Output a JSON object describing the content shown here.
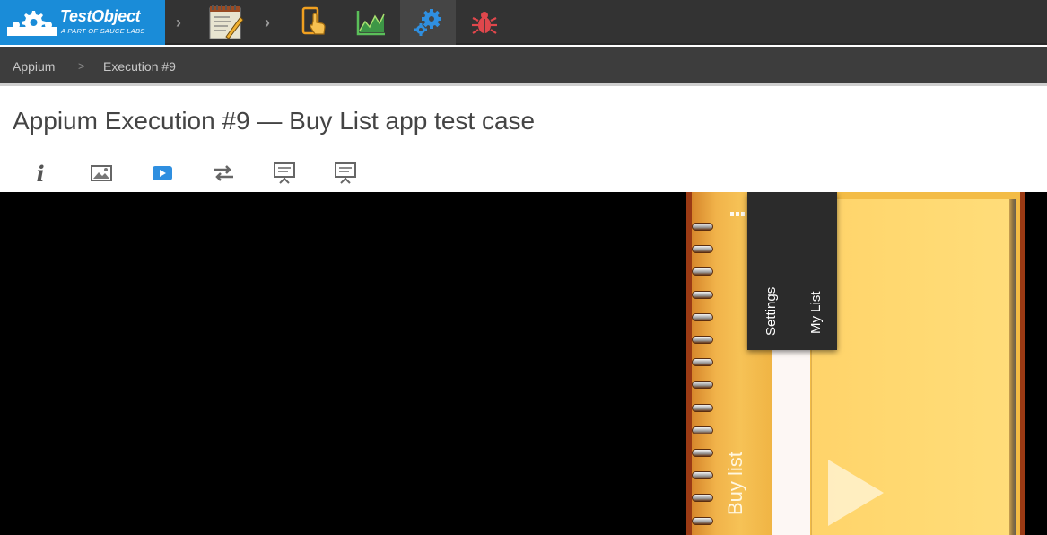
{
  "brand": {
    "title": "TestObject",
    "subtitle": "A PART OF SAUCE LABS"
  },
  "nav": {
    "items": [
      {
        "name": "notepad-icon"
      },
      {
        "name": "touch-device-icon"
      },
      {
        "name": "line-chart-icon"
      },
      {
        "name": "gears-icon",
        "active": true
      },
      {
        "name": "bug-icon"
      }
    ]
  },
  "breadcrumb": {
    "items": [
      "Appium",
      "Execution #9"
    ],
    "separator": ">"
  },
  "page": {
    "title": "Appium Execution #9 — Buy List app test case"
  },
  "tabs": [
    {
      "name": "info-icon"
    },
    {
      "name": "image-icon"
    },
    {
      "name": "video-icon",
      "active": true
    },
    {
      "name": "swap-icon"
    },
    {
      "name": "presentation-icon"
    },
    {
      "name": "presentation-icon-2"
    }
  ],
  "device": {
    "app_title": "Buy list",
    "menu_items": [
      "Settings",
      "My List"
    ]
  },
  "colors": {
    "brand": "#1a8cd8",
    "topbar": "#333333",
    "active_tab": "#2f8fe0"
  }
}
